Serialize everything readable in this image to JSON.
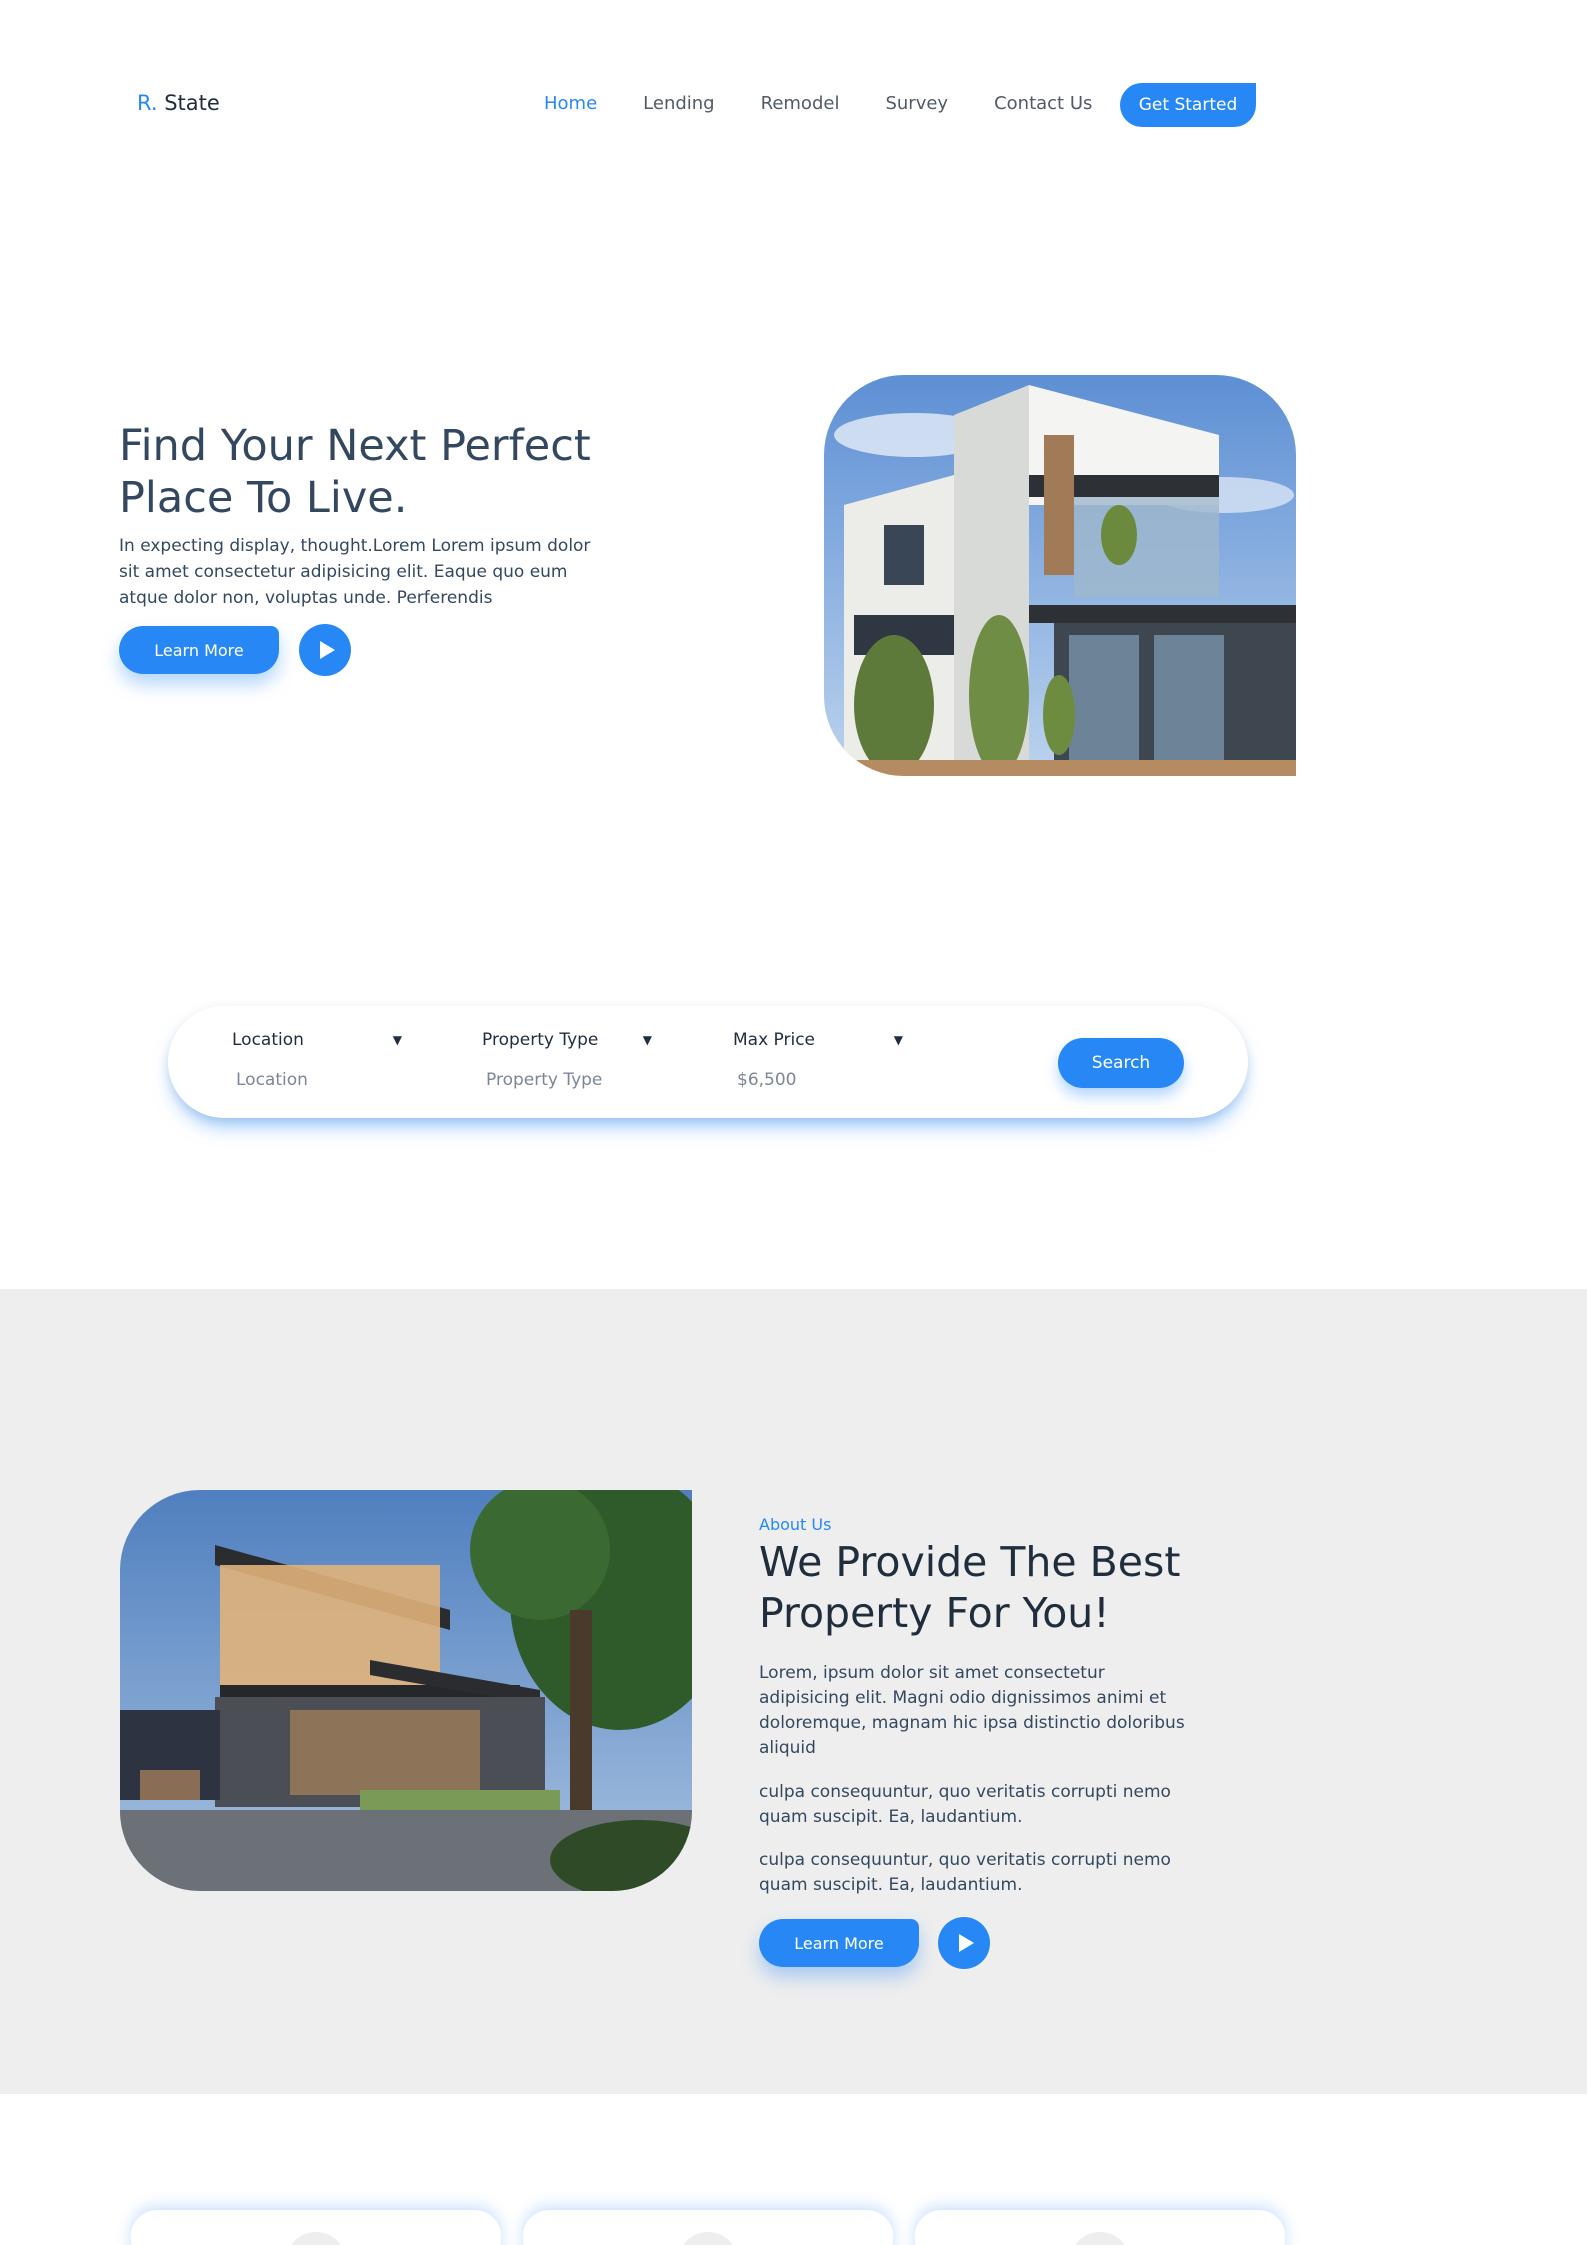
{
  "nav": {
    "logo_prefix": "R.",
    "logo_name": "State",
    "items": [
      "Home",
      "Lending",
      "Remodel",
      "Survey",
      "Contact Us"
    ],
    "cta": "Get Started"
  },
  "hero": {
    "title": "Find Your Next Perfect Place To Live.",
    "text": "In expecting display, thought.Lorem Lorem ipsum dolor sit amet consectetur adipisicing elit. Eaque quo eum atque dolor non, voluptas unde. Perferendis",
    "learn_more": "Learn More"
  },
  "search": {
    "location_label": "Location",
    "location_value": "Location",
    "type_label": "Property Type",
    "type_value": "Property Type",
    "price_label": "Max Price",
    "price_value": "$6,500",
    "button": "Search"
  },
  "about": {
    "eyebrow": "About Us",
    "title": "We Provide The Best Property For You!",
    "p1": "Lorem, ipsum dolor sit amet consectetur adipisicing elit. Magni odio dignissimos animi et doloremque, magnam hic ipsa distinctio doloribus aliquid",
    "p2": "culpa consequuntur, quo veritatis corrupti nemo quam suscipit. Ea, laudantium.",
    "p3": "culpa consequuntur, quo veritatis corrupti nemo quam suscipit. Ea, laudantium.",
    "learn_more": "Learn More"
  },
  "colors": {
    "accent": "#2788f5",
    "heading": "#33485f",
    "about_bg": "#eeeeee"
  },
  "icons": [
    "play-icon",
    "chevron-down-icon"
  ]
}
